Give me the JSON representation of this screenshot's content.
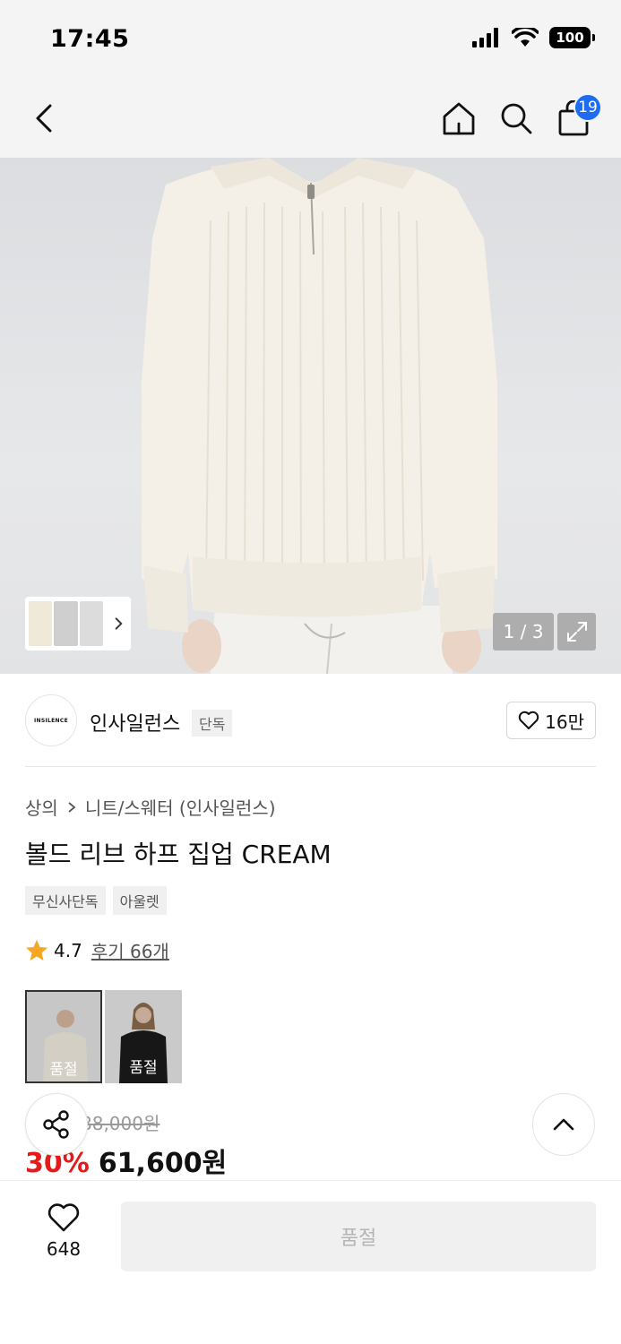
{
  "status_bar": {
    "time": "17:45",
    "battery": "100"
  },
  "header": {
    "cart_count": "19"
  },
  "gallery": {
    "page_indicator": "1 / 3"
  },
  "brand": {
    "logo_text": "INSILENCE",
    "name": "인사일런스",
    "tag": "단독",
    "likes": "16만"
  },
  "product": {
    "breadcrumb": [
      "상의",
      "니트/스웨터 (인사일런스)"
    ],
    "title": "볼드 리브 하프 집업 CREAM",
    "tags": [
      "무신사단독",
      "아울렛"
    ],
    "rating": "4.7",
    "review_label": "후기 66개",
    "color_options": [
      {
        "status": "품절",
        "color": "cream"
      },
      {
        "status": "품절",
        "color": "black"
      }
    ],
    "original_price": "88,000원",
    "discount": "30%",
    "price": "61,600원"
  },
  "bottom_bar": {
    "wish_count": "648",
    "cta_label": "품절"
  },
  "colors": {
    "accent": "#1d6cf2",
    "discount": "#e51b1b",
    "star": "#f5a623"
  }
}
